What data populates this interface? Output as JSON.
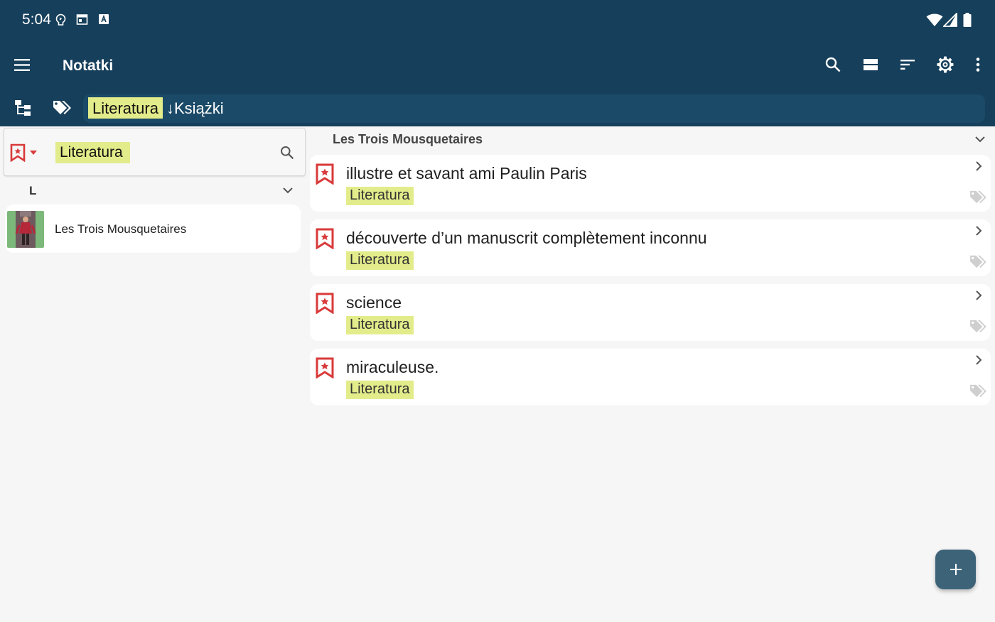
{
  "status_bar": {
    "time": "5:04",
    "left_icons": [
      "location-lightbulb-icon",
      "calendar-icon",
      "font-icon"
    ],
    "right_icons": [
      "wifi-icon",
      "signal-icon",
      "battery-icon"
    ]
  },
  "app_bar": {
    "title": "Notatki",
    "actions": [
      "search-icon",
      "view-toggle-icon",
      "sort-icon",
      "settings-icon",
      "more-vert-icon"
    ]
  },
  "breadcrumb": {
    "current": "Literatura",
    "next": "↓Książki"
  },
  "left_pane": {
    "filter_icon": "bookmark-star-icon",
    "search_value": "Literatura",
    "section_letter": "L",
    "books": [
      {
        "title": "Les Trois Mousquetaires"
      }
    ]
  },
  "right_pane": {
    "group_title": "Les Trois Mousquetaires",
    "notes": [
      {
        "text": "illustre et savant ami Paulin Paris",
        "tag": "Literatura"
      },
      {
        "text": "découverte d’un manuscrit complètement inconnu",
        "tag": "Literatura"
      },
      {
        "text": "science",
        "tag": "Literatura"
      },
      {
        "text": "miraculeuse.",
        "tag": "Literatura"
      }
    ]
  },
  "fab": {
    "icon": "plus-icon"
  },
  "colors": {
    "primary_dark": "#163f5b",
    "highlight": "#e3ec8a",
    "bookmark_red": "#d93a3a",
    "fab": "#3d6379",
    "background": "#f6f6f6"
  }
}
